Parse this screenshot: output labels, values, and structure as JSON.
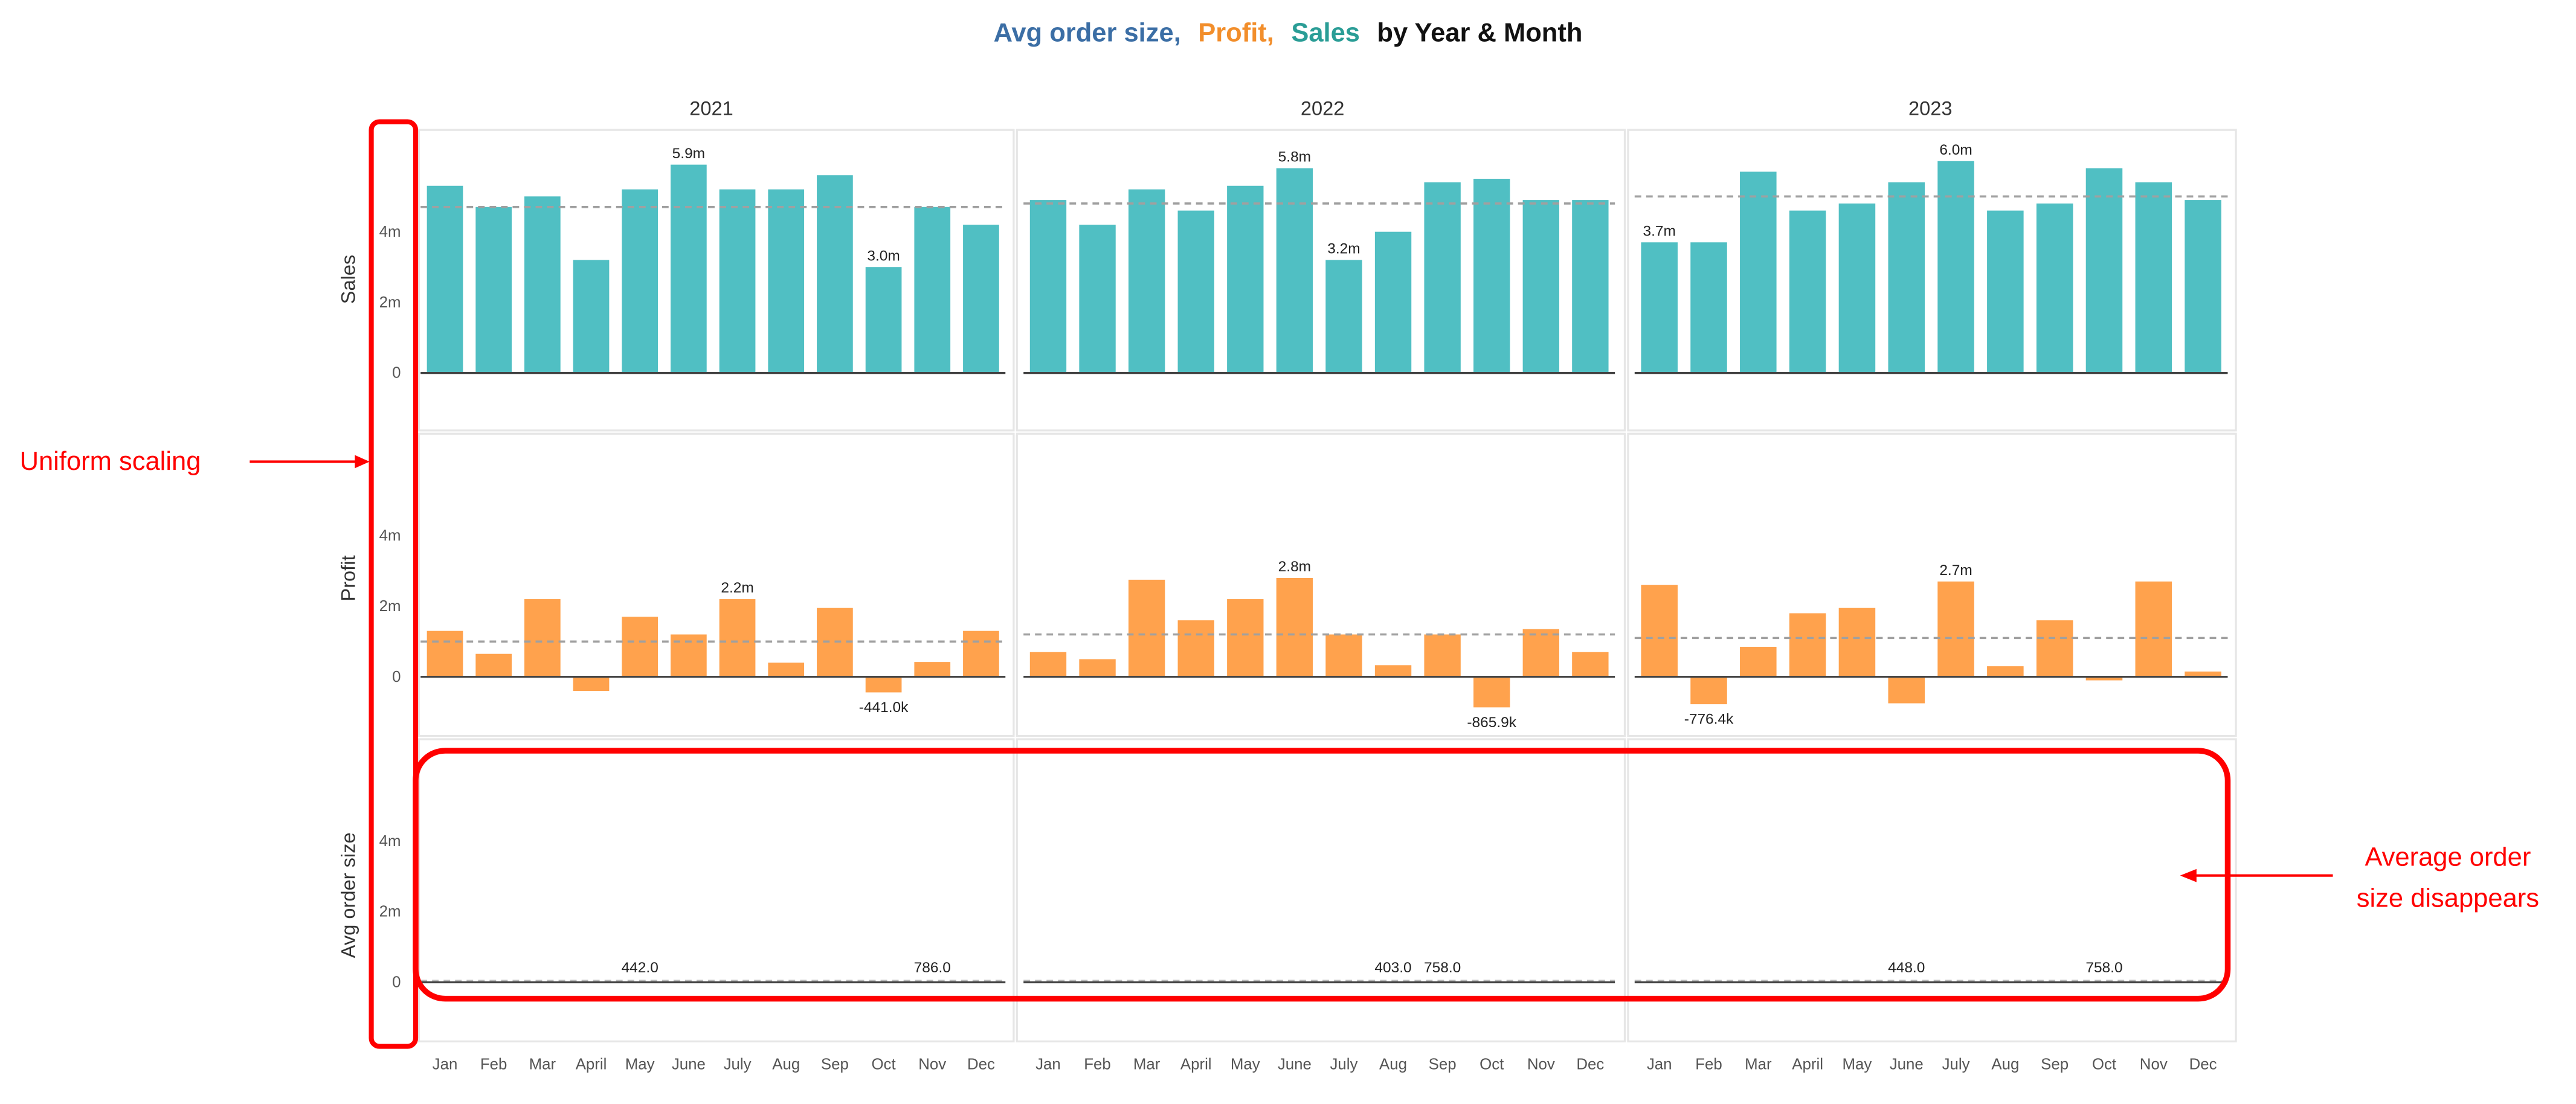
{
  "title": {
    "parts": [
      {
        "text": "Avg order size,",
        "color": "#3b6ea5"
      },
      {
        "text": "Profit,",
        "color": "#f28e2b"
      },
      {
        "text": "Sales",
        "color": "#2a9d96"
      },
      {
        "text": "by Year & Month",
        "color": "#111111"
      }
    ]
  },
  "annotations": {
    "uniform_scaling": "Uniform scaling",
    "avg_disappears_line1": "Average order",
    "avg_disappears_line2": "size disappears",
    "color": "#ff0000"
  },
  "chart_data": {
    "type": "bar",
    "title": "Avg order size, Profit, Sales by Year & Month",
    "columns": [
      "2021",
      "2022",
      "2023"
    ],
    "categories": [
      "Jan",
      "Feb",
      "Mar",
      "April",
      "May",
      "June",
      "July",
      "Aug",
      "Sep",
      "Oct",
      "Nov",
      "Dec"
    ],
    "y_ticks": [
      "0",
      "2m",
      "4m"
    ],
    "ylim": [
      -1000000,
      6500000
    ],
    "shared_y_scale": true,
    "grid": false,
    "reference_line": "average (dashed)",
    "rows": [
      {
        "name": "Sales",
        "color": "#50bfc3",
        "values": {
          "2021": [
            5300000,
            4700000,
            5000000,
            3200000,
            5200000,
            5900000,
            5200000,
            5200000,
            5600000,
            3000000,
            4700000,
            4200000
          ],
          "2022": [
            4900000,
            4200000,
            5200000,
            4600000,
            5300000,
            5800000,
            3200000,
            4000000,
            5400000,
            5500000,
            4900000,
            4900000
          ],
          "2023": [
            3700000,
            3700000,
            5700000,
            4600000,
            4800000,
            5400000,
            6000000,
            4600000,
            4800000,
            5800000,
            5400000,
            4900000
          ]
        },
        "average": {
          "2021": 4700000,
          "2022": 4800000,
          "2023": 5000000
        },
        "labels": {
          "2021": [
            {
              "month": "June",
              "text": "5.9m"
            },
            {
              "month": "Oct",
              "text": "3.0m"
            }
          ],
          "2022": [
            {
              "month": "June",
              "text": "5.8m"
            },
            {
              "month": "July",
              "text": "3.2m"
            }
          ],
          "2023": [
            {
              "month": "Jan",
              "text": "3.7m"
            },
            {
              "month": "July",
              "text": "6.0m"
            }
          ]
        }
      },
      {
        "name": "Profit",
        "color": "#ffa24d",
        "values": {
          "2021": [
            1300000,
            650000,
            2200000,
            -400000,
            1700000,
            1200000,
            2200000,
            400000,
            1950000,
            -441000,
            420000,
            1300000
          ],
          "2022": [
            700000,
            500000,
            2750000,
            1600000,
            2200000,
            2800000,
            1200000,
            330000,
            1200000,
            -865900,
            1350000,
            700000
          ],
          "2023": [
            2600000,
            -776400,
            850000,
            1800000,
            1950000,
            -750000,
            2700000,
            300000,
            1600000,
            -100000,
            2700000,
            150000
          ]
        },
        "average": {
          "2021": 1000000,
          "2022": 1200000,
          "2023": 1100000
        },
        "labels": {
          "2021": [
            {
              "month": "July",
              "text": "2.2m"
            },
            {
              "month": "Oct",
              "text": "-441.0k"
            }
          ],
          "2022": [
            {
              "month": "June",
              "text": "2.8m"
            },
            {
              "month": "Oct",
              "text": "-865.9k"
            }
          ],
          "2023": [
            {
              "month": "Feb",
              "text": "-776.4k"
            },
            {
              "month": "July",
              "text": "2.7m"
            }
          ]
        }
      },
      {
        "name": "Avg order size",
        "color": "#3b6ea5",
        "values": {
          "2021": [
            null,
            null,
            null,
            null,
            442,
            null,
            null,
            null,
            null,
            null,
            786,
            null
          ],
          "2022": [
            null,
            null,
            null,
            null,
            null,
            null,
            null,
            403,
            758,
            null,
            null,
            null
          ],
          "2023": [
            null,
            null,
            null,
            null,
            null,
            448,
            null,
            null,
            null,
            758,
            null,
            null
          ]
        },
        "labels": {
          "2021": [
            {
              "month": "May",
              "text": "442.0"
            },
            {
              "month": "Nov",
              "text": "786.0"
            }
          ],
          "2022": [
            {
              "month": "Aug",
              "text": "403.0"
            },
            {
              "month": "Sep",
              "text": "758.0"
            }
          ],
          "2023": [
            {
              "month": "June",
              "text": "448.0"
            },
            {
              "month": "Oct",
              "text": "758.0"
            }
          ]
        }
      }
    ]
  }
}
